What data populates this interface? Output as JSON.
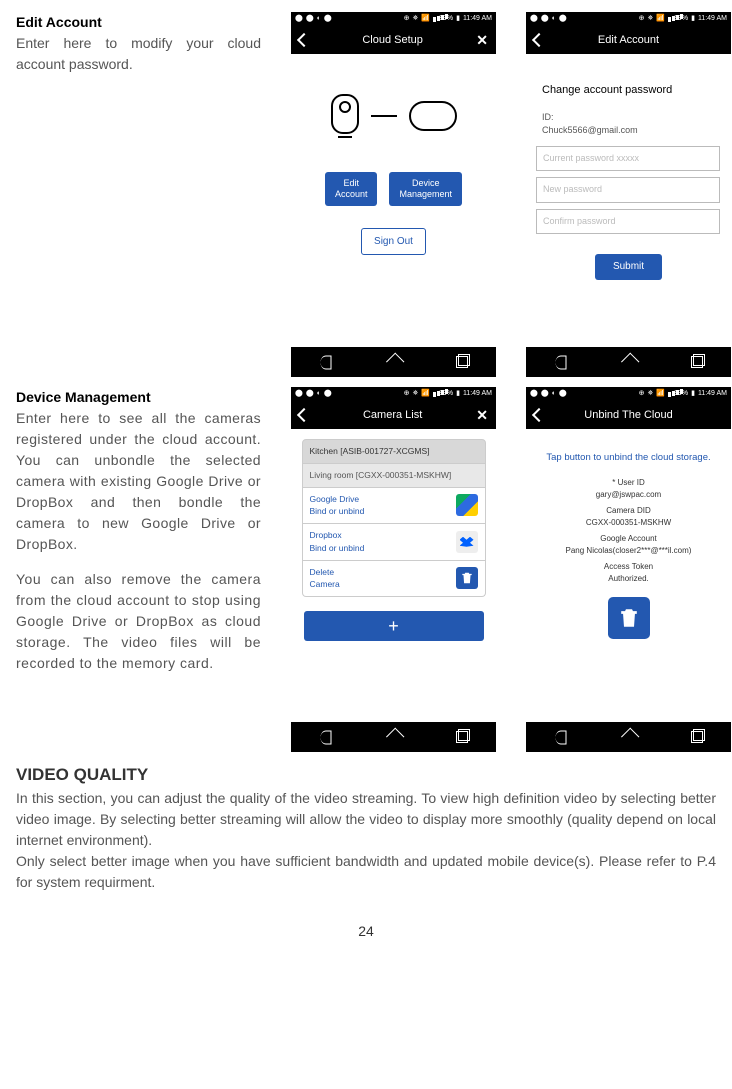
{
  "sec1": {
    "heading": "Edit Account",
    "body": "Enter here to modify your cloud account password."
  },
  "sec2": {
    "heading": "Device Management",
    "body1": "Enter here to see all the cameras registered under the cloud account.  You can unbondle the selected camera with existing Google Drive or DropBox and then bondle the camera to new Google Drive or DropBox.",
    "body2": "You can also remove the camera from the cloud account to stop using Google Drive or DropBox as cloud storage. The video files will be recorded to the memory card."
  },
  "sec3": {
    "heading": "VIDEO QUALITY",
    "body1": "In this section, you can adjust the quality of the video streaming. To view high definition video by selecting better video image. By selecting better streaming will allow the video to display more smoothly (quality depend on local internet environment).",
    "body2": "Only select better image when you have sufficient bandwidth and updated mobile device(s). Please refer to P.4 for system requirment."
  },
  "status": {
    "battery": "89%",
    "time": "11:49 AM"
  },
  "phone1": {
    "title": "Cloud Setup",
    "btn1a": "Edit",
    "btn1b": "Account",
    "btn2a": "Device",
    "btn2b": "Management",
    "signout": "Sign Out"
  },
  "phone2": {
    "title": "Edit Account",
    "heading": "Change account password",
    "idLabel": "ID:",
    "idValue": "Chuck5566@gmail.com",
    "ph_current": "Current password xxxxx",
    "ph_new": "New password",
    "ph_confirm": "Confirm password",
    "submit": "Submit"
  },
  "phone3": {
    "title": "Camera List",
    "cam1": "Kitchen [ASIB-001727-XCGMS]",
    "cam2": "Living room [CGXX-000351-MSKHW]",
    "a1a": "Google Drive",
    "a1b": "Bind or unbind",
    "a2a": "Dropbox",
    "a2b": "Bind or unbind",
    "a3a": "Delete",
    "a3b": "Camera",
    "plus": "+"
  },
  "phone4": {
    "title": "Unbind The Cloud",
    "tap": "Tap button to unbind the cloud storage.",
    "l1": "* User ID",
    "l2": "gary@jswpac.com",
    "l3": "Camera DID",
    "l4": "CGXX-000351-MSKHW",
    "l5": "Google Account",
    "l6": "Pang Nicolas(closer2***@***il.com)",
    "l7": "Access Token",
    "l8": "Authorized."
  },
  "pageNumber": "24"
}
